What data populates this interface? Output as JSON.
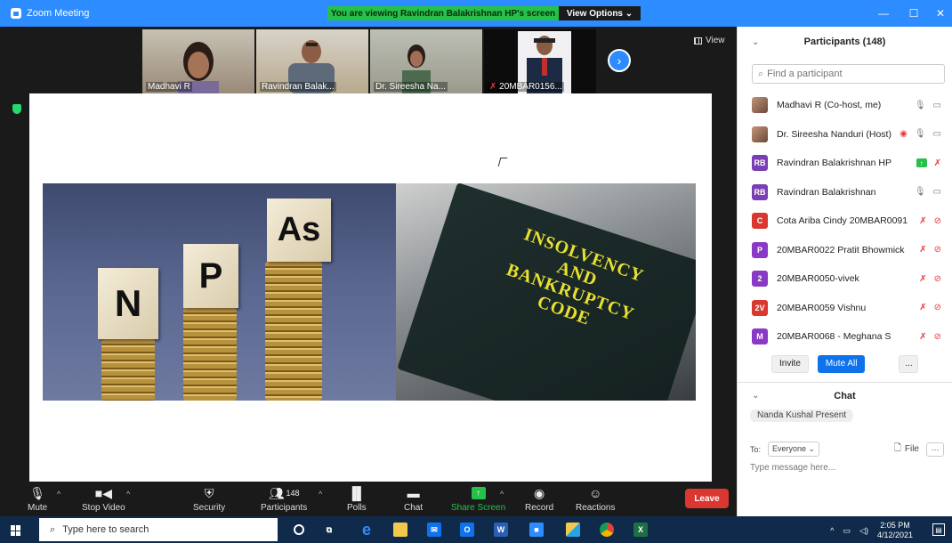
{
  "window": {
    "title": "Zoom Meeting",
    "viewing_banner": "You are viewing Ravindran Balakrishnan HP's screen",
    "view_options": "View Options ⌄"
  },
  "gallery": {
    "thumbnails": [
      {
        "name": "Madhavi R",
        "muted": false
      },
      {
        "name": "Ravindran Balak...",
        "muted": false
      },
      {
        "name": "Dr. Sireesha Na...",
        "muted": false
      },
      {
        "name": "20MBAR0156...",
        "muted": true
      }
    ],
    "view_label": "View"
  },
  "slide": {
    "npa_letters": [
      "N",
      "P",
      "As"
    ],
    "book_text": [
      "INSOLVENCY",
      "AND",
      "BANKRUPTCY",
      "CODE"
    ]
  },
  "toolbar": {
    "mute": "Mute",
    "stop_video": "Stop Video",
    "security": "Security",
    "participants": "Participants",
    "participants_count": "148",
    "polls": "Polls",
    "chat": "Chat",
    "share_screen": "Share Screen",
    "record": "Record",
    "reactions": "Reactions",
    "leave": "Leave"
  },
  "participants_panel": {
    "title": "Participants (148)",
    "search_placeholder": "Find a participant",
    "items": [
      {
        "name": "Madhavi R (Co-host, me)",
        "avatar": "photo",
        "initials": "",
        "color": "#c49479",
        "mic": "on",
        "cam": "on"
      },
      {
        "name": "Dr. Sireesha Nanduri (Host)",
        "avatar": "photo",
        "initials": "",
        "color": "#8a6a4a",
        "mic": "on",
        "cam": "on",
        "recording": true
      },
      {
        "name": "Ravindran Balakrishnan HP",
        "avatar": "initials",
        "initials": "RB",
        "color": "#7b3fb5",
        "mic": "muted",
        "sharing": true
      },
      {
        "name": "Ravindran Balakrishnan",
        "avatar": "initials",
        "initials": "RB",
        "color": "#7b3fb5",
        "mic": "on",
        "cam": "on"
      },
      {
        "name": "Cota Ariba Cindy  20MBAR0091",
        "avatar": "initials",
        "initials": "C",
        "color": "#d9372f",
        "mic": "muted",
        "cam": "off"
      },
      {
        "name": "20MBAR0022 Pratit Bhowmick",
        "avatar": "initials",
        "initials": "P",
        "color": "#8a39c4",
        "mic": "muted",
        "cam": "off"
      },
      {
        "name": "20MBAR0050-vivek",
        "avatar": "initials",
        "initials": "2",
        "color": "#8a39c4",
        "mic": "muted",
        "cam": "off"
      },
      {
        "name": "20MBAR0059 Vishnu",
        "avatar": "initials",
        "initials": "2V",
        "color": "#d9372f",
        "mic": "muted",
        "cam": "off"
      },
      {
        "name": "20MBAR0068 - Meghana S",
        "avatar": "initials",
        "initials": "M",
        "color": "#8a39c4",
        "mic": "muted",
        "cam": "off"
      }
    ],
    "invite": "Invite",
    "mute_all": "Mute All",
    "more": "..."
  },
  "chat_panel": {
    "title": "Chat",
    "last_message": "Nanda Kushal Present",
    "to_label": "To:",
    "to_value": "Everyone ⌄",
    "file": "File",
    "more": "···",
    "input_placeholder": "Type message here..."
  },
  "taskbar": {
    "search_placeholder": "Type here to search",
    "time": "2:05 PM",
    "date": "4/12/2021"
  },
  "colors": {
    "zoom_blue": "#2d8cff",
    "viewing_green": "#26c14a",
    "leave_red": "#d9372f",
    "taskbar": "#0f2a4a"
  }
}
